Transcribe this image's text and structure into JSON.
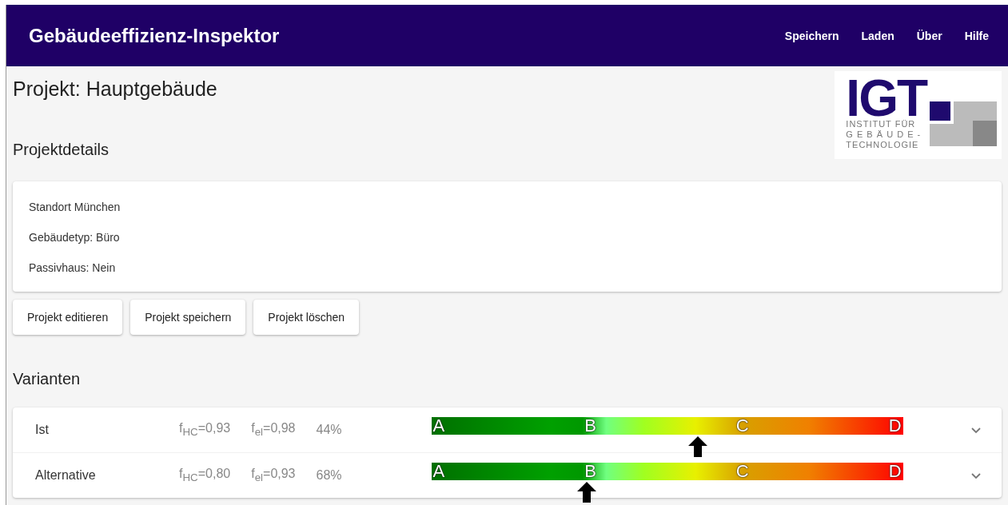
{
  "app_bar": {
    "title": "Gebäudeeffizienz-Inspektor",
    "menu": [
      "Speichern",
      "Laden",
      "Über",
      "Hilfe"
    ]
  },
  "project": {
    "title": "Projekt: Hauptgebäude",
    "section_title": "Projektdetails",
    "details": [
      "Standort München",
      "Gebäudetyp: Büro",
      "Passivhaus: Nein"
    ],
    "buttons": [
      "Projekt editieren",
      "Projekt speichern",
      "Projekt löschen"
    ]
  },
  "logo": {
    "mark": "IGT",
    "lines": [
      "INSTITUT FÜR",
      "G E B Ä U D E -",
      "TECHNOLOGIE"
    ]
  },
  "variants": {
    "title": "Varianten",
    "items": [
      {
        "name": "Ist",
        "f_hc": "f$_{HC}$=0,93",
        "f_el": "f$_{el}$=0,98",
        "percent": "44%",
        "scale_labels": [
          "A",
          "B",
          "C",
          "D"
        ],
        "level": 0.566,
        "expanded": false
      },
      {
        "name": "Alternative",
        "f_hc": "f$_{HC}$=0,80",
        "f_el": "f$_{el}$=0,93",
        "percent": "68%",
        "scale_labels": [
          "A",
          "B",
          "C",
          "D"
        ],
        "level": 0.33,
        "expanded": false
      }
    ]
  }
}
